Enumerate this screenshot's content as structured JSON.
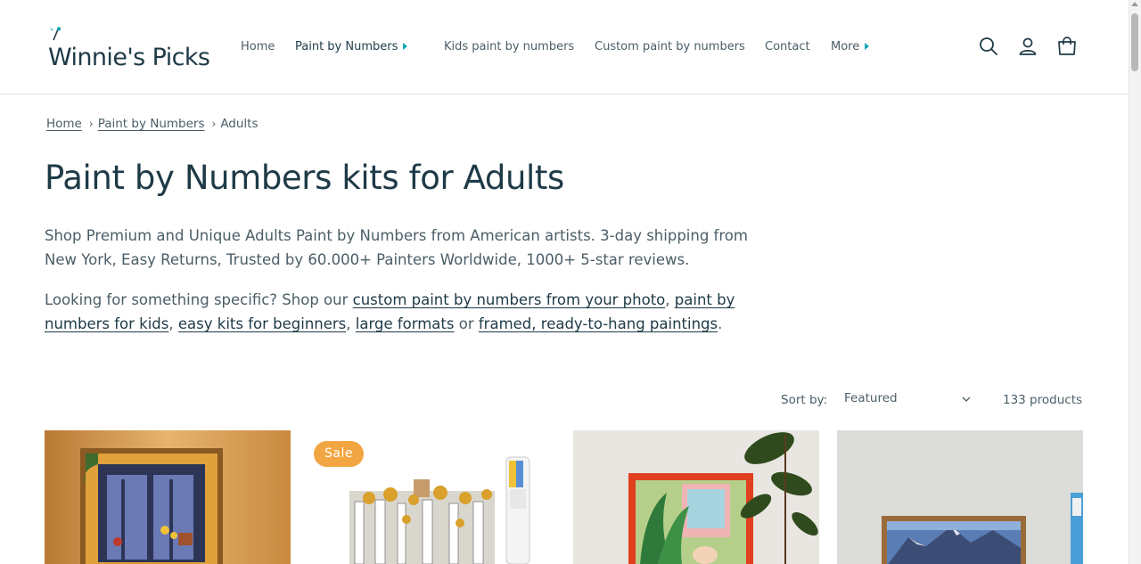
{
  "header": {
    "logo_text": "Winnie's Picks",
    "nav": [
      {
        "label": "Home",
        "has_caret": false
      },
      {
        "label": "Paint by Numbers",
        "has_caret": true
      },
      {
        "label": "Kids paint by numbers",
        "has_caret": false
      },
      {
        "label": "Custom paint by numbers",
        "has_caret": false
      },
      {
        "label": "Contact",
        "has_caret": false
      },
      {
        "label": "More",
        "has_caret": true
      }
    ],
    "icons": [
      "search-icon",
      "account-icon",
      "cart-icon"
    ],
    "accent_color": "#12a8b5"
  },
  "breadcrumb": {
    "items": [
      "Home",
      "Paint by Numbers"
    ],
    "current": "Adults"
  },
  "page": {
    "title": "Paint by Numbers kits for Adults",
    "description": "Shop Premium and Unique Adults Paint by Numbers from American artists. 3-day shipping from New York, Easy Returns, Trusted by 60.000+ Painters Worldwide, 1000+ 5-star reviews.",
    "looking_prefix": "Looking for something specific? Shop our ",
    "links": [
      "custom paint by numbers from your photo",
      "paint by numbers for kids",
      "easy kits for beginners",
      "large formats",
      "framed, ready-to-hang paintings"
    ],
    "sep_comma": ", ",
    "sep_or": " or ",
    "end": "."
  },
  "sort": {
    "label": "Sort by:",
    "selected": "Featured",
    "count": "133 products"
  },
  "products": [
    {
      "name": "product-card-1",
      "sale": false
    },
    {
      "name": "product-card-2",
      "sale": true,
      "badge": "Sale",
      "badge_color": "#f2a641"
    },
    {
      "name": "product-card-3",
      "sale": false
    },
    {
      "name": "product-card-4",
      "sale": false
    }
  ]
}
